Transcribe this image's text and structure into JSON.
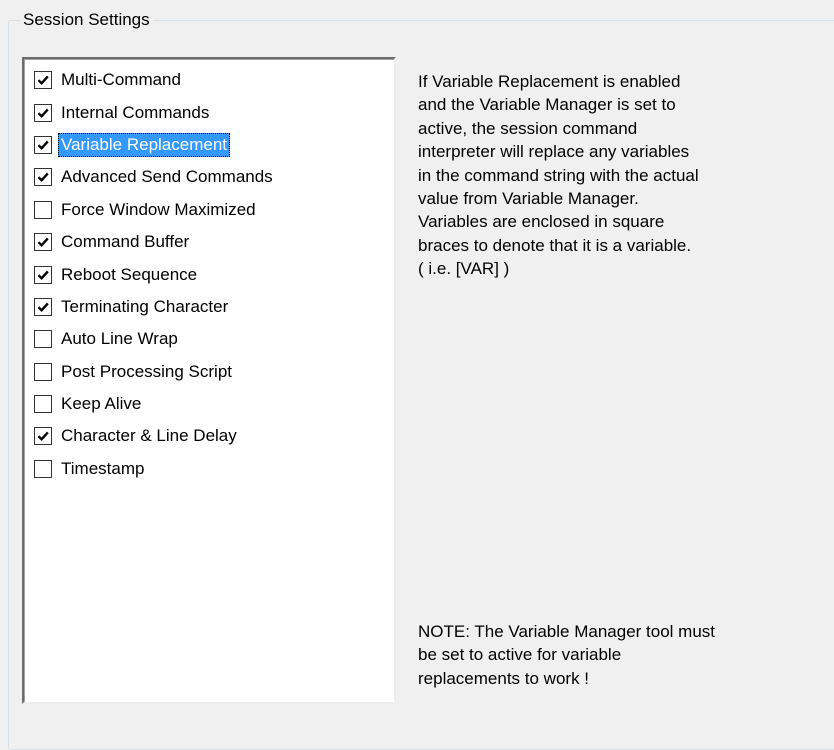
{
  "group": {
    "title": "Session Settings"
  },
  "options": [
    {
      "label": "Multi-Command",
      "checked": true,
      "selected": false
    },
    {
      "label": "Internal Commands",
      "checked": true,
      "selected": false
    },
    {
      "label": "Variable Replacement",
      "checked": true,
      "selected": true
    },
    {
      "label": "Advanced Send Commands",
      "checked": true,
      "selected": false
    },
    {
      "label": "Force Window Maximized",
      "checked": false,
      "selected": false
    },
    {
      "label": "Command Buffer",
      "checked": true,
      "selected": false
    },
    {
      "label": "Reboot Sequence",
      "checked": true,
      "selected": false
    },
    {
      "label": "Terminating Character",
      "checked": true,
      "selected": false
    },
    {
      "label": "Auto Line Wrap",
      "checked": false,
      "selected": false
    },
    {
      "label": "Post Processing Script",
      "checked": false,
      "selected": false
    },
    {
      "label": "Keep Alive",
      "checked": false,
      "selected": false
    },
    {
      "label": "Character & Line Delay",
      "checked": true,
      "selected": false
    },
    {
      "label": "Timestamp",
      "checked": false,
      "selected": false
    }
  ],
  "description": "If Variable Replacement is enabled\nand the Variable Manager is set to\nactive, the session command\ninterpreter will replace any variables\nin the command string with the actual\nvalue from Variable Manager.\nVariables are enclosed in square\nbraces to denote that it is a variable.\n( i.e.  [VAR] )",
  "note": "NOTE: The Variable Manager tool must\nbe set to active for variable\nreplacements to work !",
  "colors": {
    "selection": "#3399ff",
    "background": "#f0f0f0"
  }
}
